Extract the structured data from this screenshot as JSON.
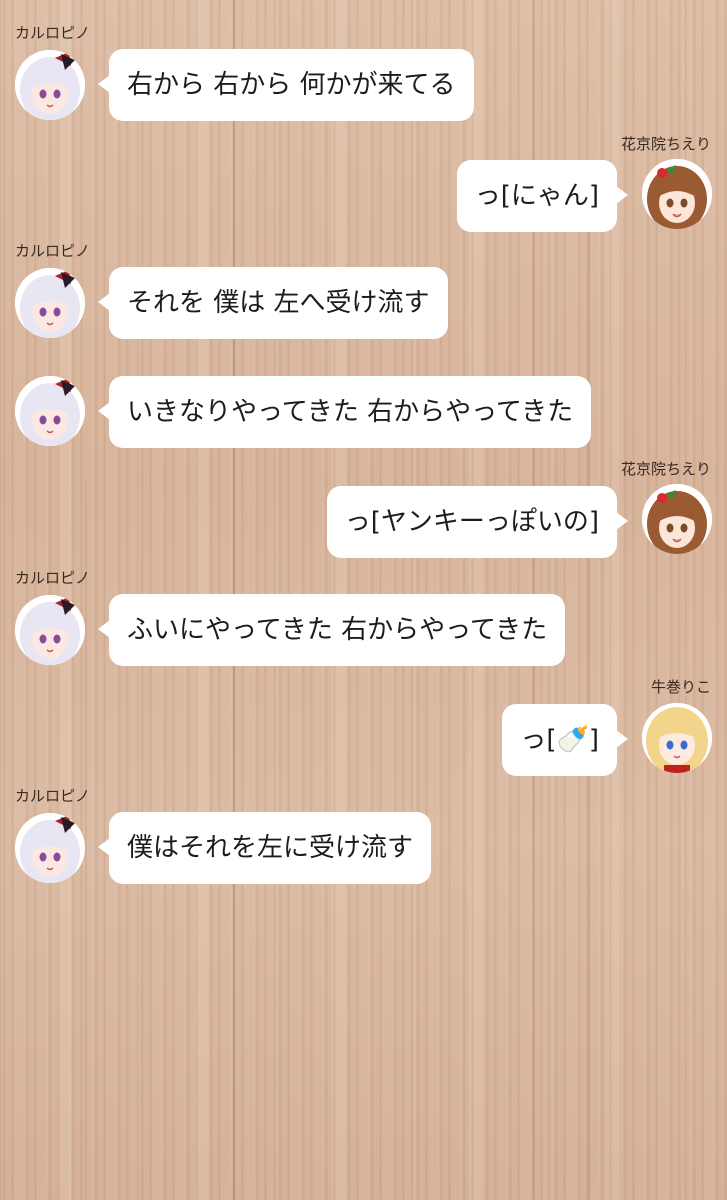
{
  "messages": [
    {
      "sender": "カルロピノ",
      "text": "右から 右から 何かが来てる",
      "side": "left"
    },
    {
      "sender": "花京院ちえり",
      "text": "っ[にゃん]",
      "side": "right"
    },
    {
      "sender": "カルロピノ",
      "text": "それを 僕は 左へ受け流す",
      "side": "left"
    },
    {
      "sender": "",
      "text": "いきなりやってきた 右からやってきた",
      "side": "left"
    },
    {
      "sender": "花京院ちえり",
      "text": "っ[ヤンキーっぽいの]",
      "side": "right"
    },
    {
      "sender": "カルロピノ",
      "text": "ふいにやってきた 右からやってきた",
      "side": "left"
    },
    {
      "sender": "牛巻りこ",
      "text": "っ[🍼]",
      "side": "right"
    },
    {
      "sender": "カルロピノ",
      "text": "僕はそれを左に受け流す",
      "side": "left"
    }
  ],
  "avatars": {
    "carlo": {
      "hair": "#e9e6f3",
      "accent": "#2a1a24",
      "ribbon": "#b0202a",
      "eyes": "#8a4a9a"
    },
    "chieri": {
      "hair": "#9a5a32",
      "accent": "#3a8a3a",
      "ribbon": "#d82a2a",
      "eyes": "#7a4a2a"
    },
    "riko": {
      "hair": "#f2d58a",
      "accent": "#3a6ad0",
      "ribbon": "#c02020",
      "eyes": "#3a6ad0"
    }
  },
  "colors": {
    "bubble": "#ffffff",
    "text": "#1c1c1c",
    "name": "#3a2a22",
    "wood": "#d9b69c"
  }
}
